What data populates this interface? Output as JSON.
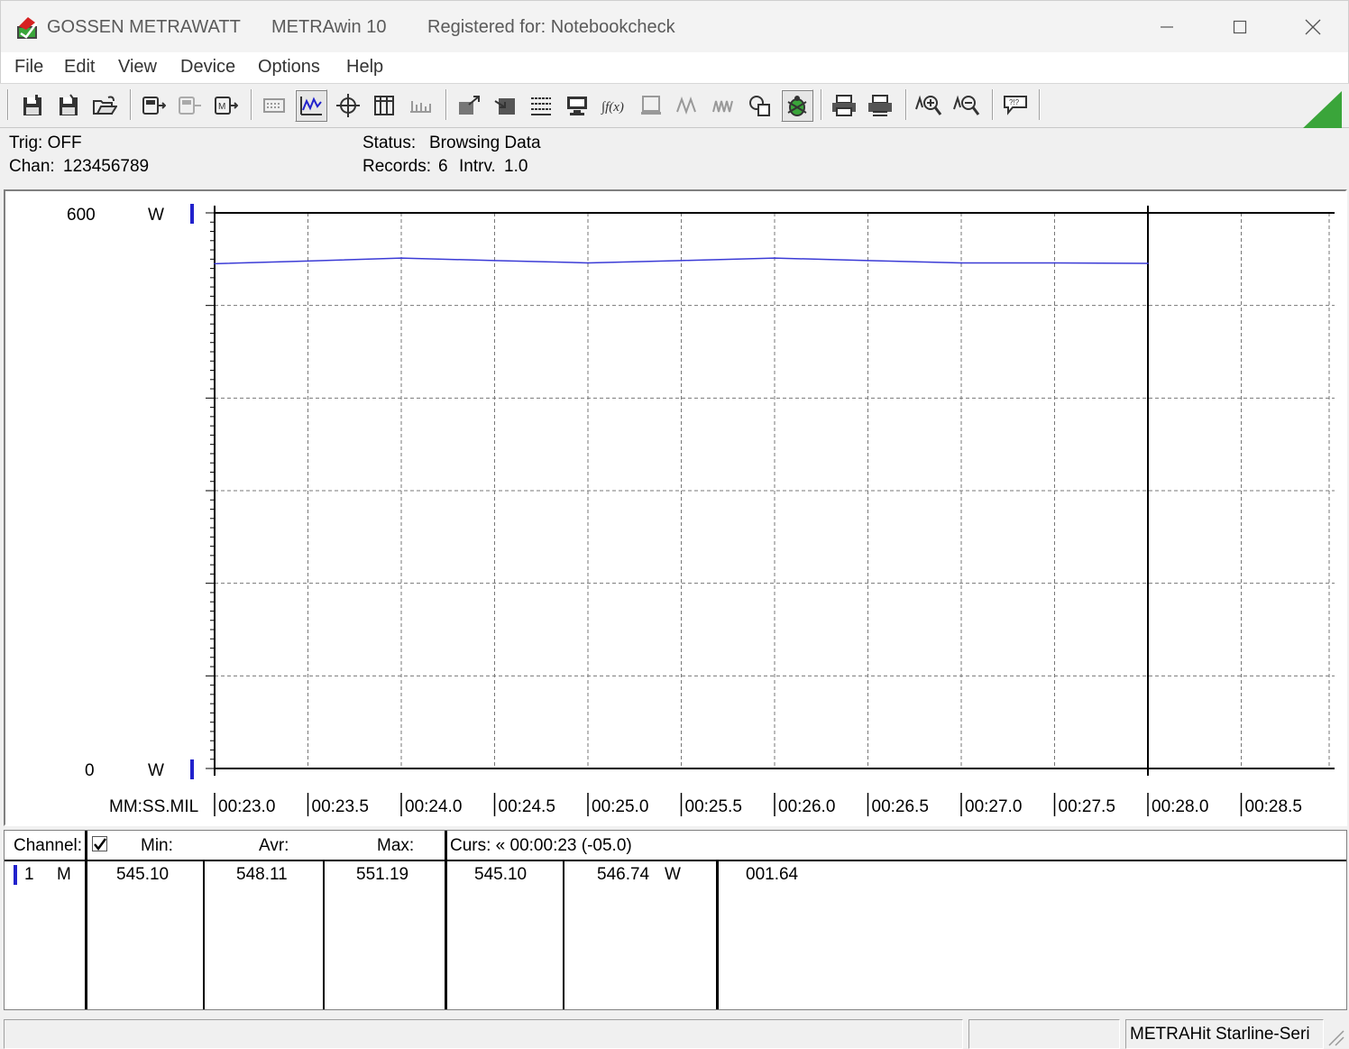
{
  "titlebar": {
    "brand": "GOSSEN METRAWATT",
    "app": "METRAwin 10",
    "registration": "Registered for: Notebookcheck"
  },
  "menu": [
    "File",
    "Edit",
    "View",
    "Device",
    "Options",
    "Help"
  ],
  "toolbar": {
    "buttons": [
      "save-icon",
      "save-as-icon",
      "open-icon",
      "device-read-icon",
      "device-disabled-icon",
      "device-write-icon",
      "keyboard-icon",
      "scope-view-icon",
      "crosshair-icon",
      "table-view-icon",
      "bar-scale-icon",
      "export-icon",
      "import-icon",
      "list-icon",
      "monitor-icon",
      "function-icon",
      "display-icon",
      "wave-icon",
      "multi-wave-icon",
      "search-record-icon",
      "bug-icon",
      "print-icon",
      "print-preview-icon",
      "zoom-in-icon",
      "zoom-out-icon",
      "help-icon"
    ]
  },
  "status": {
    "trig": "Trig: OFF",
    "chan_label": "Chan:",
    "chan_value": "123456789",
    "status_label": "Status:",
    "status_value": "Browsing Data",
    "records_label": "Records:",
    "records_value": "6",
    "intrv_label": "Intrv.",
    "intrv_value": "1.0"
  },
  "chart_data": {
    "type": "line",
    "ylim": [
      0,
      600
    ],
    "y_top_label": "600",
    "y_bottom_label": "0",
    "y_unit": "W",
    "x_axis_label": "MM:SS.MIL",
    "x_tick_labels": [
      "00:23.0",
      "00:23.5",
      "00:24.0",
      "00:24.5",
      "00:25.0",
      "00:25.5",
      "00:26.0",
      "00:26.5",
      "00:27.0",
      "00:27.5",
      "00:28.0",
      "00:28.5"
    ],
    "x_ticks": [
      23.0,
      23.5,
      24.0,
      24.5,
      25.0,
      25.5,
      26.0,
      26.5,
      27.0,
      27.5,
      28.0,
      28.5
    ],
    "xlim": [
      23.0,
      29.0
    ],
    "series": [
      {
        "color": "#3b3bd6",
        "x": [
          23.0,
          23.5,
          24.0,
          24.5,
          25.0,
          25.5,
          26.0,
          26.5,
          27.0,
          27.5,
          28.0
        ],
        "y": [
          545.1,
          548.0,
          551.19,
          548.5,
          546.0,
          548.5,
          551.19,
          548.5,
          546.0,
          546.0,
          545.5
        ]
      }
    ],
    "cursor_x": 28.0,
    "grid": true
  },
  "table": {
    "headers": {
      "channel": "Channel:",
      "min": "Min:",
      "avr": "Avr:",
      "max": "Max:",
      "curs": "Curs: « 00:00:23 (-05.0)"
    },
    "row": {
      "num": "1",
      "mode": "M",
      "min": "545.10",
      "avr": "548.11",
      "max": "551.19",
      "curs1": "545.10",
      "curs2": "546.74",
      "unit": "W",
      "diff": "001.64"
    }
  },
  "statusbar": {
    "device": "METRAHit Starline-Seri"
  },
  "colors": {
    "series": "#3b3bd6",
    "accent_green": "#3aa53a"
  }
}
